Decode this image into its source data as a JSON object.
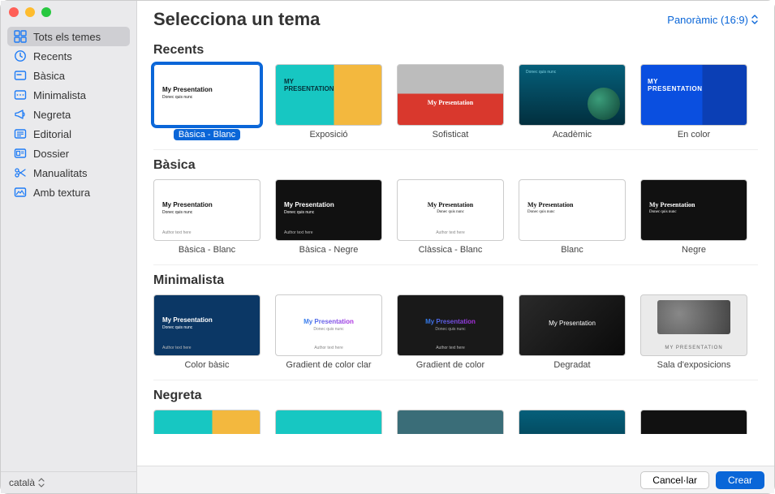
{
  "header": {
    "title": "Selecciona un tema"
  },
  "aspect": {
    "label": "Panoràmic (16:9)"
  },
  "sidebar": {
    "items": [
      {
        "label": "Tots els temes",
        "icon": "grid"
      },
      {
        "label": "Recents",
        "icon": "clock"
      },
      {
        "label": "Bàsica",
        "icon": "basic"
      },
      {
        "label": "Minimalista",
        "icon": "minimal"
      },
      {
        "label": "Negreta",
        "icon": "bold"
      },
      {
        "label": "Editorial",
        "icon": "editorial"
      },
      {
        "label": "Dossier",
        "icon": "dossier"
      },
      {
        "label": "Manualitats",
        "icon": "craft"
      },
      {
        "label": "Amb textura",
        "icon": "texture"
      }
    ]
  },
  "language": "català",
  "thumb_placeholder": "My Presentation",
  "thumb_sub": "Donec quis nunc",
  "thumb_author": "Author text here",
  "sections": {
    "recents": {
      "title": "Recents"
    },
    "basica": {
      "title": "Bàsica"
    },
    "minimalista": {
      "title": "Minimalista"
    },
    "negreta": {
      "title": "Negreta"
    }
  },
  "themes": {
    "recents": [
      {
        "label": "Bàsica - Blanc"
      },
      {
        "label": "Exposició"
      },
      {
        "label": "Sofisticat"
      },
      {
        "label": "Acadèmic"
      },
      {
        "label": "En color"
      }
    ],
    "basica": [
      {
        "label": "Bàsica - Blanc"
      },
      {
        "label": "Bàsica - Negre"
      },
      {
        "label": "Clàssica - Blanc"
      },
      {
        "label": "Blanc"
      },
      {
        "label": "Negre"
      }
    ],
    "minimalista": [
      {
        "label": "Color bàsic"
      },
      {
        "label": "Gradient de color clar"
      },
      {
        "label": "Gradient de color"
      },
      {
        "label": "Degradat"
      },
      {
        "label": "Sala d'exposicions"
      }
    ]
  },
  "footer": {
    "cancel": "Cancel·lar",
    "create": "Crear"
  }
}
